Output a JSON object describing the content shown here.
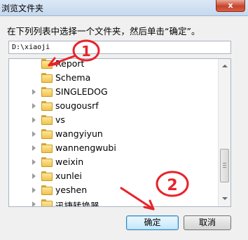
{
  "window": {
    "title": "浏览文件夹",
    "close_glyph": "x"
  },
  "prompt": "在下列列表中选择一个文件夹，然后单击“确定”。",
  "path": {
    "value": "D:\\xiaoji"
  },
  "tree": {
    "items": [
      {
        "label": "Report",
        "expander": false
      },
      {
        "label": "Schema",
        "expander": false
      },
      {
        "label": "SINGLEDOG",
        "expander": true
      },
      {
        "label": "sougousrf",
        "expander": true
      },
      {
        "label": "vs",
        "expander": true
      },
      {
        "label": "wangyiyun",
        "expander": true
      },
      {
        "label": "wannengwubi",
        "expander": true
      },
      {
        "label": "weixin",
        "expander": true
      },
      {
        "label": "xunlei",
        "expander": true
      },
      {
        "label": "yeshen",
        "expander": true
      },
      {
        "label": "迅捷转换器",
        "expander": true
      }
    ]
  },
  "buttons": {
    "ok": "确定",
    "cancel": "取消"
  },
  "annotations": {
    "one": "1",
    "two": "2",
    "color": "#e8232a"
  }
}
